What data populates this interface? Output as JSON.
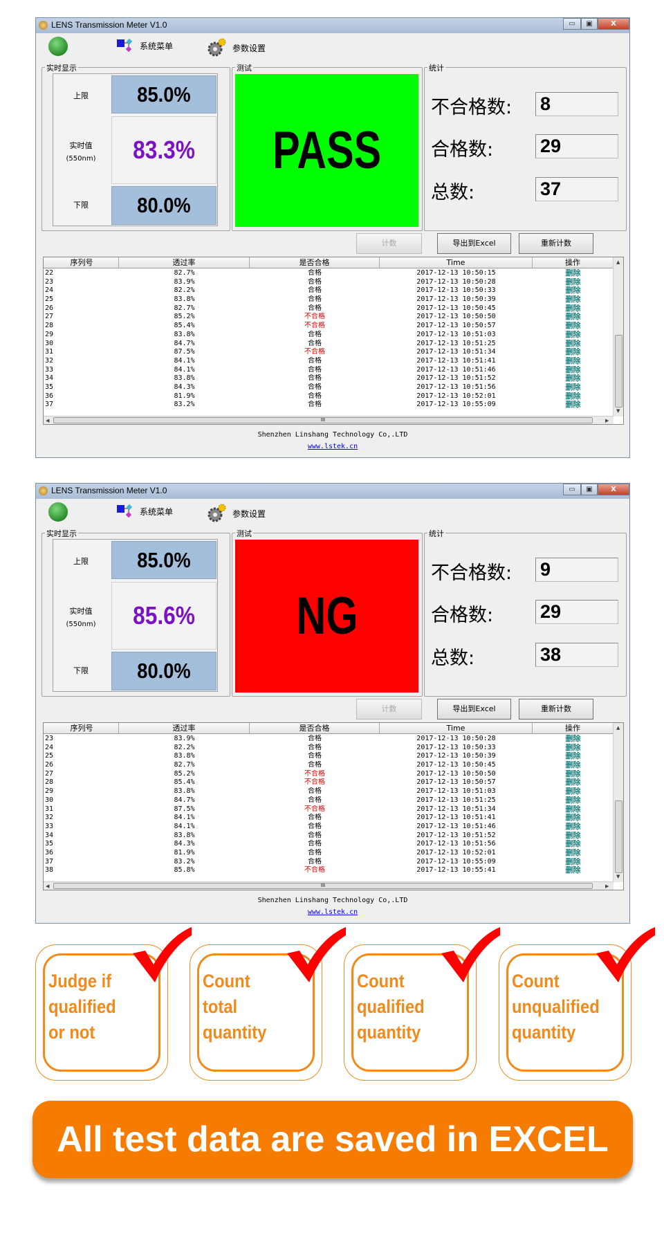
{
  "windows": [
    {
      "title": "LENS Transmission Meter V1.0",
      "toolbar": {
        "system_menu": "系统菜单",
        "params": "参数设置"
      },
      "realtime": {
        "group": "实时显示",
        "upper_label": "上限",
        "upper": "85.0%",
        "current_label": "实时值",
        "wavelength": "(550nm)",
        "current": "83.3%",
        "lower_label": "下限",
        "lower": "80.0%"
      },
      "test": {
        "group": "测试",
        "result": "PASS",
        "color": "#00ff00"
      },
      "stats": {
        "group": "统计",
        "fail_label": "不合格数:",
        "fail": "8",
        "pass_label": "合格数:",
        "pass": "29",
        "total_label": "总数:",
        "total": "37"
      },
      "buttons": {
        "count": "计数",
        "export": "导出到Excel",
        "reset": "重新计数"
      },
      "columns": [
        "序列号",
        "透过率",
        "是否合格",
        "Time",
        "操作"
      ],
      "rows": [
        [
          "22",
          "82.7%",
          "合格",
          "2017-12-13 10:50:15",
          "删除"
        ],
        [
          "23",
          "83.9%",
          "合格",
          "2017-12-13 10:50:28",
          "删除"
        ],
        [
          "24",
          "82.2%",
          "合格",
          "2017-12-13 10:50:33",
          "删除"
        ],
        [
          "25",
          "83.8%",
          "合格",
          "2017-12-13 10:50:39",
          "删除"
        ],
        [
          "26",
          "82.7%",
          "合格",
          "2017-12-13 10:50:45",
          "删除"
        ],
        [
          "27",
          "85.2%",
          "不合格",
          "2017-12-13 10:50:50",
          "删除"
        ],
        [
          "28",
          "85.4%",
          "不合格",
          "2017-12-13 10:50:57",
          "删除"
        ],
        [
          "29",
          "83.8%",
          "合格",
          "2017-12-13 10:51:03",
          "删除"
        ],
        [
          "30",
          "84.7%",
          "合格",
          "2017-12-13 10:51:25",
          "删除"
        ],
        [
          "31",
          "87.5%",
          "不合格",
          "2017-12-13 10:51:34",
          "删除"
        ],
        [
          "32",
          "84.1%",
          "合格",
          "2017-12-13 10:51:41",
          "删除"
        ],
        [
          "33",
          "84.1%",
          "合格",
          "2017-12-13 10:51:46",
          "删除"
        ],
        [
          "34",
          "83.8%",
          "合格",
          "2017-12-13 10:51:52",
          "删除"
        ],
        [
          "35",
          "84.3%",
          "合格",
          "2017-12-13 10:51:56",
          "删除"
        ],
        [
          "36",
          "81.9%",
          "合格",
          "2017-12-13 10:52:01",
          "删除"
        ],
        [
          "37",
          "83.2%",
          "合格",
          "2017-12-13 10:55:09",
          "删除"
        ]
      ],
      "footer": "Shenzhen Linshang Technology Co,.LTD",
      "link": "www.lstek.cn"
    },
    {
      "title": "LENS Transmission Meter V1.0",
      "toolbar": {
        "system_menu": "系统菜单",
        "params": "参数设置"
      },
      "realtime": {
        "group": "实时显示",
        "upper_label": "上限",
        "upper": "85.0%",
        "current_label": "实时值",
        "wavelength": "(550nm)",
        "current": "85.6%",
        "lower_label": "下限",
        "lower": "80.0%"
      },
      "test": {
        "group": "测试",
        "result": "NG",
        "color": "#ff0000"
      },
      "stats": {
        "group": "统计",
        "fail_label": "不合格数:",
        "fail": "9",
        "pass_label": "合格数:",
        "pass": "29",
        "total_label": "总数:",
        "total": "38"
      },
      "buttons": {
        "count": "计数",
        "export": "导出到Excel",
        "reset": "重新计数"
      },
      "columns": [
        "序列号",
        "透过率",
        "是否合格",
        "Time",
        "操作"
      ],
      "rows": [
        [
          "23",
          "83.9%",
          "合格",
          "2017-12-13 10:50:28",
          "删除"
        ],
        [
          "24",
          "82.2%",
          "合格",
          "2017-12-13 10:50:33",
          "删除"
        ],
        [
          "25",
          "83.8%",
          "合格",
          "2017-12-13 10:50:39",
          "删除"
        ],
        [
          "26",
          "82.7%",
          "合格",
          "2017-12-13 10:50:45",
          "删除"
        ],
        [
          "27",
          "85.2%",
          "不合格",
          "2017-12-13 10:50:50",
          "删除"
        ],
        [
          "28",
          "85.4%",
          "不合格",
          "2017-12-13 10:50:57",
          "删除"
        ],
        [
          "29",
          "83.8%",
          "合格",
          "2017-12-13 10:51:03",
          "删除"
        ],
        [
          "30",
          "84.7%",
          "合格",
          "2017-12-13 10:51:25",
          "删除"
        ],
        [
          "31",
          "87.5%",
          "不合格",
          "2017-12-13 10:51:34",
          "删除"
        ],
        [
          "32",
          "84.1%",
          "合格",
          "2017-12-13 10:51:41",
          "删除"
        ],
        [
          "33",
          "84.1%",
          "合格",
          "2017-12-13 10:51:46",
          "删除"
        ],
        [
          "34",
          "83.8%",
          "合格",
          "2017-12-13 10:51:52",
          "删除"
        ],
        [
          "35",
          "84.3%",
          "合格",
          "2017-12-13 10:51:56",
          "删除"
        ],
        [
          "36",
          "81.9%",
          "合格",
          "2017-12-13 10:52:01",
          "删除"
        ],
        [
          "37",
          "83.2%",
          "合格",
          "2017-12-13 10:55:09",
          "删除"
        ],
        [
          "38",
          "85.8%",
          "不合格",
          "2017-12-13 10:55:41",
          "删除"
        ]
      ],
      "footer": "Shenzhen Linshang Technology Co,.LTD",
      "link": "www.lstek.cn"
    }
  ],
  "window_controls": {
    "minimize": "▭",
    "maximize": "▣",
    "close": "X"
  },
  "scroll_grip": "III",
  "features": [
    {
      "lines": [
        "Judge if",
        "qualified",
        "or not"
      ]
    },
    {
      "lines": [
        "Count",
        "total",
        "quantity"
      ]
    },
    {
      "lines": [
        "Count",
        "qualified",
        "quantity"
      ]
    },
    {
      "lines": [
        "Count",
        "unqualified",
        "quantity"
      ]
    }
  ],
  "banner": "All test data are saved in EXCEL",
  "colors": {
    "accent": "#f08a1c",
    "banner": "#f57c00",
    "fail_text": "#ee0000",
    "delete_link": "#1a8080",
    "limit_box": "#a3bfdc",
    "current_value": "#7a12c4"
  }
}
